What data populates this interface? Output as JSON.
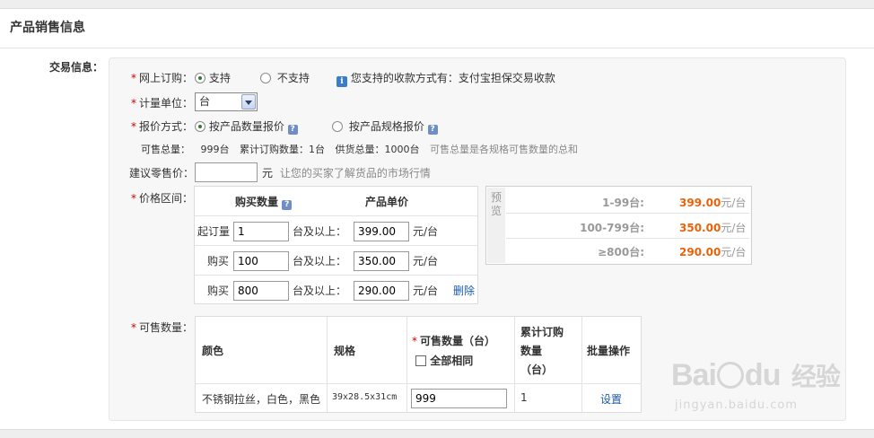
{
  "header": {
    "title": "产品销售信息"
  },
  "section": {
    "label": "交易信息："
  },
  "online_order": {
    "label": "网上订购：",
    "option_support": "支持",
    "option_not_support": "不支持",
    "selected": "支持",
    "info_text": "您支持的收款方式有：支付宝担保交易收款"
  },
  "unit": {
    "label": "计量单位：",
    "value": "台"
  },
  "quote": {
    "label": "报价方式：",
    "option_by_qty": "按产品数量报价",
    "option_by_spec": "按产品规格报价",
    "selected": "按产品数量报价"
  },
  "stats": {
    "total_label": "可售总量：",
    "total_value": "999台",
    "ordered_label": "累计订购数量：",
    "ordered_value": "1台",
    "supply_label": "供货总量：",
    "supply_value": "1000台",
    "hint": "可售总量是各规格可售数量的总和"
  },
  "retail": {
    "label": "建议零售价：",
    "value": "",
    "unit": "元",
    "hint": "让您的买家了解货品的市场行情"
  },
  "price_range": {
    "label": "价格区间：",
    "col_qty": "购买数量",
    "col_price": "产品单价",
    "rows": [
      {
        "prefix": "起订量",
        "qty": "1",
        "suffix": "台及以上：",
        "price": "399.00",
        "unit": "元/台",
        "action": ""
      },
      {
        "prefix": "购买",
        "qty": "100",
        "suffix": "台及以上：",
        "price": "350.00",
        "unit": "元/台",
        "action": ""
      },
      {
        "prefix": "购买",
        "qty": "800",
        "suffix": "台及以上：",
        "price": "290.00",
        "unit": "元/台",
        "action": "删除"
      }
    ]
  },
  "preview": {
    "tag": "预览",
    "rows": [
      {
        "range": "1-99台:",
        "price": "399.00",
        "unit": "元/台"
      },
      {
        "range": "100-799台:",
        "price": "350.00",
        "unit": "元/台"
      },
      {
        "range": "≥800台:",
        "price": "290.00",
        "unit": "元/台"
      }
    ]
  },
  "sellable": {
    "label": "可售数量：",
    "headers": {
      "color": "颜色",
      "spec": "规格",
      "qty": "可售数量（台）",
      "all_same": "全部相同",
      "ordered_line1": "累计订购",
      "ordered_line2": "数量",
      "ordered_line3": "（台）",
      "batch": "批量操作"
    },
    "row": {
      "color": "不锈钢拉丝，白色，黑色",
      "spec": "39x28.5x31cm",
      "qty": "999",
      "ordered": "1",
      "action": "设置"
    }
  },
  "watermark": {
    "brand": "Bai",
    "brand2": "du",
    "cn": "经验",
    "url": "jingyan.baidu.com"
  },
  "colors": {
    "required": "#cc0000",
    "price": "#e8630a",
    "link": "#1a5aa8",
    "radio_dot": "#2d7d2d"
  },
  "icons": [
    "info-icon",
    "help-icon",
    "chevron-down-icon",
    "checkbox-icon"
  ]
}
